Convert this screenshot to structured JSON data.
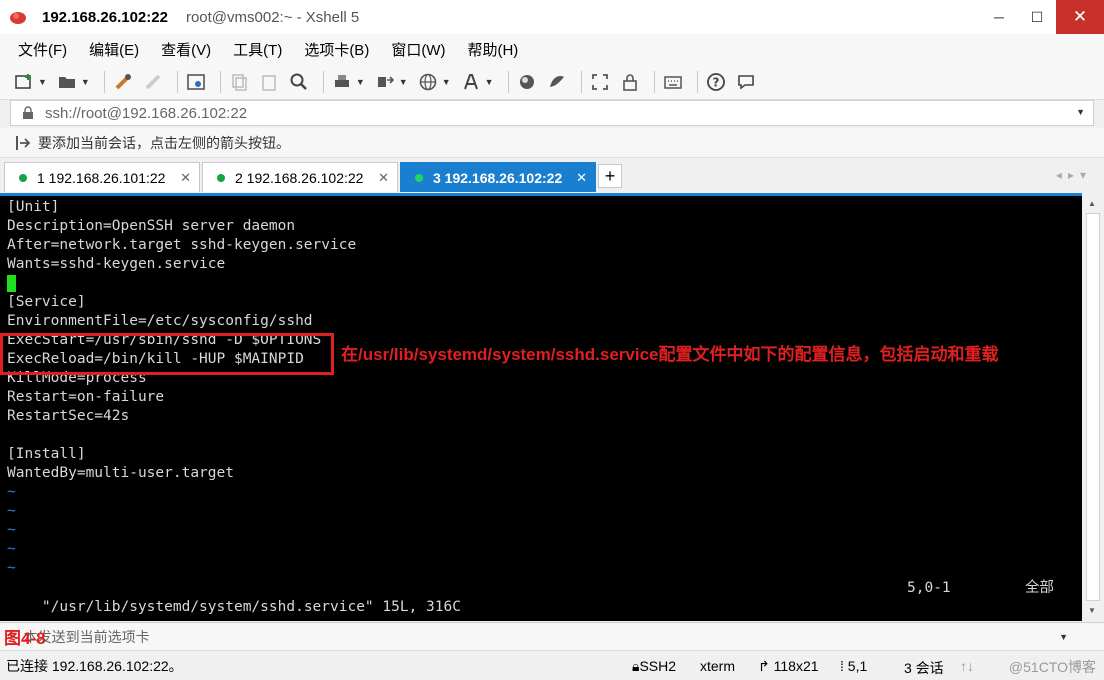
{
  "window": {
    "host": "192.168.26.102:22",
    "subtitle": "root@vms002:~ - Xshell 5",
    "minimize": "─",
    "maximize": "☐",
    "close": "✕"
  },
  "menu": [
    "文件(F)",
    "编辑(E)",
    "查看(V)",
    "工具(T)",
    "选项卡(B)",
    "窗口(W)",
    "帮助(H)"
  ],
  "address": {
    "value": "ssh://root@192.168.26.102:22"
  },
  "hint": "要添加当前会话，点击左侧的箭头按钮。",
  "tabs": [
    {
      "label": "1 192.168.26.101:22"
    },
    {
      "label": "2 192.168.26.102:22"
    },
    {
      "label": "3 192.168.26.102:22"
    }
  ],
  "tab_add": "+",
  "terminal": {
    "lines": [
      "[Unit]",
      "Description=OpenSSH server daemon",
      "After=network.target sshd-keygen.service",
      "Wants=sshd-keygen.service",
      "",
      "[Service]",
      "EnvironmentFile=/etc/sysconfig/sshd",
      "ExecStart=/usr/sbin/sshd -D $OPTIONS",
      "ExecReload=/bin/kill -HUP $MAINPID",
      "KillMode=process",
      "Restart=on-failure",
      "RestartSec=42s",
      "",
      "[Install]",
      "WantedBy=multi-user.target",
      "~",
      "~",
      "~",
      "~",
      "~"
    ],
    "status_file": "\"/usr/lib/systemd/system/sshd.service\" 15L, 316C",
    "status_pos": "5,0-1",
    "status_all": "全部"
  },
  "annotation": "在/usr/lib/systemd/system/sshd.service配置文件中如下的配置信息，包括启动和重载",
  "figure_label": "图4-8",
  "send_placeholder": "本发送到当前选项卡",
  "statusbar": {
    "connection": "已连接 192.168.26.102:22。",
    "protocol": "SSH2",
    "terminal_type": "xterm",
    "size": "118x21",
    "cursor": "5,1",
    "sessions": "3 会话",
    "watermark": "@51CTO博客"
  },
  "colors": {
    "accent": "#1a7fcf",
    "annotation": "#e02020",
    "cursor": "#1ee01e",
    "tilde": "#3a7de0"
  }
}
